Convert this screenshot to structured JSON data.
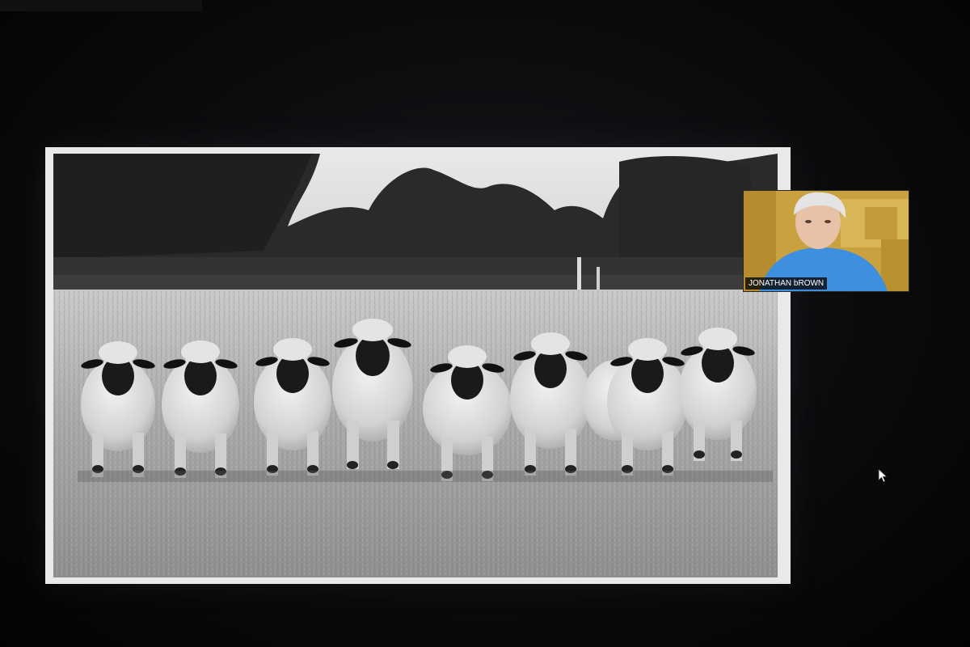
{
  "participant": {
    "name": "JONATHAN bROWN"
  },
  "icons": {
    "cursor": "mouse-pointer-icon"
  },
  "colors": {
    "background": "#050506",
    "tile_background": "#c8a03c",
    "label_background": "#0a0a0a",
    "label_text": "#ffffff"
  }
}
